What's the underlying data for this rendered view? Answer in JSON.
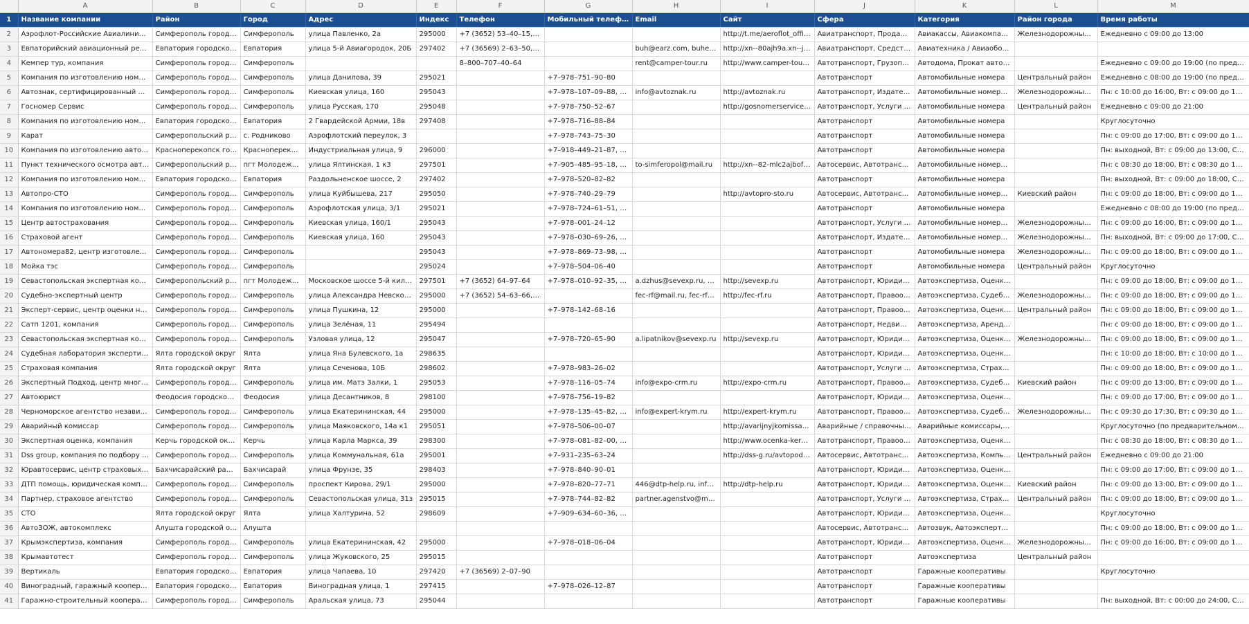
{
  "columns": [
    "A",
    "B",
    "C",
    "D",
    "E",
    "F",
    "G",
    "H",
    "I",
    "J",
    "K",
    "L",
    "M"
  ],
  "header": [
    "Название компании",
    "Район",
    "Город",
    "Адрес",
    "Индекс",
    "Телефон",
    "Мобильный телефон",
    "Email",
    "Сайт",
    "Сфера",
    "Категория",
    "Район города",
    "Время работы"
  ],
  "rows": [
    [
      "Аэрофлот-Российские Авиалинии, ав...",
      "Симферополь городск...",
      "Симферополь",
      "улица Павленко, 2а",
      "295000",
      "+7 (3652) 53–40–15, +7...",
      "",
      "",
      "http://t.me/aeroflot_offici...",
      "Авиатранспорт, Продажа ...",
      "Авиакассы, Авиакомпании",
      "Железнодорожный р...",
      "Ежедневно с 09:00 до 13:00"
    ],
    [
      "Евпаторийский авиационный ремонт...",
      "Евпатория городской ...",
      "Евпатория",
      "улица 5-й Авиагородок, 20Б",
      "297402",
      "+7 (36569) 2–63–50, +7...",
      "",
      "buh@earz.com, buhear...",
      "http://xn--80ajh9a.xn--j1a...",
      "Авиатранспорт, Средства ...",
      "Авиатехника / Авиаобору...",
      "",
      ""
    ],
    [
      "Кемпер тур, компания",
      "Симферополь городск...",
      "Симферополь",
      "",
      "",
      "8–800–707–40–64",
      "",
      "rent@camper-tour.ru",
      "http://www.camper-tour.ru",
      "Автотранспорт, Грузопере...",
      "Автодома, Прокат автотра...",
      "",
      "Ежедневно с 09:00 до 19:00 (по предвари..."
    ],
    [
      "Компания по изготовлению номерны...",
      "Симферополь городск...",
      "Симферополь",
      "улица Данилова, 39",
      "295021",
      "",
      "+7–978–751–90–80",
      "",
      "",
      "Автотранспорт",
      "Автомобильные номера",
      "Центральный район",
      "Ежедневно с 08:00 до 19:00 (по предвари..."
    ],
    [
      "Автознак, сертифицированный центр",
      "Симферополь городск...",
      "Симферополь",
      "Киевская улица, 160",
      "295043",
      "",
      "+7–978–107–09–88, +7...",
      "info@avtoznak.ru",
      "http://avtoznak.ru",
      "Автотранспорт, Издательс...",
      "Автомобильные номера, К...",
      "Железнодорожный р...",
      "Пн: с 10:00 до 16:00, Вт: с 09:00 до 18:00, С..."
    ],
    [
      "Госномер Сервис",
      "Симферополь городск...",
      "Симферополь",
      "улица Русская, 170",
      "295048",
      "",
      "+7–978–750–52–67",
      "",
      "http://gosnomerservice.ru",
      "Автотранспорт, Услуги стр...",
      "Автомобильные номера",
      "Центральный район",
      "Ежедневно с 09:00 до 21:00"
    ],
    [
      "Компания по изготовлению номерны...",
      "Евпатория городской ...",
      "Евпатория",
      "2 Гвардейской Армии, 18в",
      "297408",
      "",
      "+7–978–716–88–84",
      "",
      "",
      "Автотранспорт",
      "Автомобильные номера",
      "",
      "Круглосуточно"
    ],
    [
      "Карат",
      "Симферопольский рай...",
      "с. Родниково",
      "Аэрофлотский переулок, 3",
      "",
      "",
      "+7–978–743–75–30",
      "",
      "",
      "Автотранспорт",
      "Автомобильные номера",
      "",
      "Пн: с 09:00 до 17:00, Вт: с 09:00 до 17:00, С..."
    ],
    [
      "Компания по изготовлению автомоб...",
      "Красноперекопск горо...",
      "Красноперекоп...",
      "Индустриальная улица, 9",
      "296000",
      "",
      "+7–918–449–21–87, +7...",
      "",
      "",
      "Автотранспорт",
      "Автомобильные номера",
      "",
      "Пн: выходной, Вт: с 09:00 до 13:00, Ср: с 0..."
    ],
    [
      "Пункт технического осмотра автотра...",
      "Симферопольский рай...",
      "пгт Молодежное",
      "улица Ялтинская, 1 к3",
      "297501",
      "",
      "+7–905–485–95–18, +7...",
      "to-simferopol@mail.ru",
      "http://xn--82-mlc2ajbofgf...",
      "Автосервис, Автотранспор...",
      "Автомобильные номера, ...",
      "",
      "Пн: с 08:30 до 18:00, Вт: с 08:30 до 18:00, С..."
    ],
    [
      "Компания по изготовлению номерны...",
      "Евпатория городской ...",
      "Евпатория",
      "Раздольненское шоссе, 2",
      "297402",
      "",
      "+7–978–520–82–82",
      "",
      "",
      "Автотранспорт",
      "Автомобильные номера",
      "",
      "Пн: выходной, Вт: с 09:00 до 18:00, Ср: с 0..."
    ],
    [
      "Автопро-СТО",
      "Симферополь городск...",
      "Симферополь",
      "улица Куйбышева, 217",
      "295050",
      "",
      "+7–978–740–29–79",
      "",
      "http://avtopro-sto.ru",
      "Автосервис, Автотранспорт",
      "Автомобильные номера, А...",
      "Киевский район",
      "Пн: с 09:00 до 18:00, Вт: с 09:00 до 18:00, С..."
    ],
    [
      "Компания по изготовлению номерны...",
      "Симферополь городск...",
      "Симферополь",
      "Аэрофлотская улица, 3/1",
      "295021",
      "",
      "+7–978–724–61–51, +7...",
      "",
      "",
      "Автотранспорт",
      "Автомобильные номера",
      "",
      "Ежедневно с 08:00 до 19:00 (по предвари..."
    ],
    [
      "Центр автострахования",
      "Симферополь городск...",
      "Симферополь",
      "Киевская улица, 160/1",
      "295043",
      "",
      "+7–978–001–24–12",
      "",
      "",
      "Автотранспорт, Услуги стр...",
      "Автомобильные номера, С...",
      "Железнодорожный р...",
      "Пн: с 09:00 до 16:00, Вт: с 09:00 до 17:00, С..."
    ],
    [
      "Страховой агент",
      "Симферополь городск...",
      "Симферополь",
      "Киевская улица, 160",
      "295043",
      "",
      "+7–978–030–69–26, +7...",
      "",
      "",
      "Автотранспорт, Издательс...",
      "Автомобильные номера, К...",
      "Железнодорожный р...",
      "Пн: выходной, Вт: с 09:00 до 17:00, Ср: с 0..."
    ],
    [
      "Автономера82, центр изготовления н...",
      "Симферополь городск...",
      "Симферополь",
      "",
      "295043",
      "",
      "+7–978–869–73–98, +7...",
      "",
      "",
      "Автотранспорт",
      "Автомобильные номера",
      "Железнодорожный р...",
      "Пн: с 09:00 до 18:00, Вт: с 09:00 до 18:00, С..."
    ],
    [
      "Мойка тэс",
      "Симферополь городск...",
      "Симферополь",
      "",
      "295024",
      "",
      "+7–978–504–06–40",
      "",
      "",
      "Автотранспорт",
      "Автомобильные номера",
      "Центральный район",
      "Круглосуточно"
    ],
    [
      "Севастопольская экспертная компания",
      "Симферопольский рай...",
      "пгт Молодежное",
      "Московское шоссе 5-й килом...",
      "297501",
      "+7 (3652) 64–97–64",
      "+7–978–010–92–35, +7...",
      "a.dzhus@sevexp.ru, a.sc...",
      "http://sevexp.ru",
      "Автотранспорт, Юридичес...",
      "Автоэкспертиза, Оценка с...",
      "",
      "Пн: с 09:00 до 18:00, Вт: с 09:00 до 18:00, С..."
    ],
    [
      "Судебно-экспертный центр",
      "Симферополь городск...",
      "Симферополь",
      "улица Александра Невского, 12",
      "295000",
      "+7 (3652) 54–63–66, 8–...",
      "",
      "fec-rf@mail.ru, fec-rf12...",
      "http://fec-rf.ru",
      "Автотранспорт, Правоохр...",
      "Автоэкспертиза, Судебная ...",
      "Железнодорожный р...",
      "Пн: с 09:00 до 18:00, Вт: с 09:00 до 18:00, С..."
    ],
    [
      "Эксперт-сервис, центр оценки недви...",
      "Симферополь городск...",
      "Симферополь",
      "улица Пушкина, 12",
      "295000",
      "",
      "+7–978–142–68–16",
      "",
      "",
      "Автотранспорт, Правоохр...",
      "Автоэкспертиза, Оценка с...",
      "Центральный район",
      "Пн: с 09:00 до 18:00, Вт: с 09:00 до 18:00, С..."
    ],
    [
      "Сатп 1201, компания",
      "Симферополь городск...",
      "Симферополь",
      "улица Зелёная, 11",
      "295494",
      "",
      "",
      "",
      "",
      "Автотранспорт, Недвижим...",
      "Автоэкспертиза, Аренда п...",
      "",
      "Пн: с 09:00 до 18:00, Вт: с 09:00 до 18:00, С..."
    ],
    [
      "Севастопольская экспертная компания",
      "Симферополь городск...",
      "Симферополь",
      "Узловая улица, 12",
      "295047",
      "",
      "+7–978–720–65–90",
      "a.lipatnikov@sevexp.ru",
      "http://sevexp.ru",
      "Автотранспорт, Юридичес...",
      "Автоэкспертиза, Оценка с...",
      "Железнодорожный р...",
      "Пн: с 09:00 до 18:00, Вт: с 09:00 до 18:00, С..."
    ],
    [
      "Судебная лаборатория экспертизы и ...",
      "Ялта городской округ",
      "Ялта",
      "улица Яна Булевского, 1а",
      "298635",
      "",
      "",
      "",
      "",
      "Автотранспорт, Юридичес...",
      "Автоэкспертиза, Оценка с...",
      "",
      "Пн: с 10:00 до 18:00, Вт: с 10:00 до 18:00, С..."
    ],
    [
      "Страховая компания",
      "Ялта городской округ",
      "Ялта",
      "улица Сеченова, 10Б",
      "298602",
      "",
      "+7–978–983–26–02",
      "",
      "",
      "Автотранспорт, Услуги стр...",
      "Автоэкспертиза, Страхова...",
      "",
      "Пн: с 09:00 до 18:00, Вт: с 09:00 до 18:00, С..."
    ],
    [
      "Экспертный Подход, центр многопро...",
      "Симферополь городск...",
      "Симферополь",
      "улица им. Матэ Залки, 1",
      "295053",
      "",
      "+7–978–116–05–74",
      "info@expo-crm.ru",
      "http://expo-crm.ru",
      "Автотранспорт, Правоохр...",
      "Автоэкспертиза, Судебная ...",
      "Киевский район",
      "Пн: с 09:00 до 13:00, Вт: с 09:00 до 13:00, С..."
    ],
    [
      "Автоюрист",
      "Феодосия городской о...",
      "Феодосия",
      "улица Десантников, 8",
      "298100",
      "",
      "+7–978–756–19–82",
      "",
      "",
      "Автотранспорт, Юридичес...",
      "Автоэкспертиза, Оценка с...",
      "",
      "Пн: с 09:00 до 17:00, Вт: с 09:00 до 17:00, С..."
    ],
    [
      "Черноморское агентство независимы...",
      "Симферополь городск...",
      "Симферополь",
      "улица Екатерининская, 44",
      "295000",
      "",
      "+7–978–135–45–82, +7...",
      "info@expert-krym.ru",
      "http://expert-krym.ru",
      "Автотранспорт, Правоохр...",
      "Автоэкспертиза, Судебная ...",
      "Железнодорожный р...",
      "Пн: с 09:30 до 17:30, Вт: с 09:30 до 17:30, С..."
    ],
    [
      "Аварийный комиссар",
      "Симферополь городск...",
      "Симферополь",
      "улица Маяковского, 14а к1",
      "295051",
      "",
      "+7–978–506–00–07",
      "",
      "http://avarijnyjkomissarsi...",
      "Аварийные / справочные ...",
      "Аварийные комиссары, Ав...",
      "",
      "Круглосуточно (по предварительному зв..."
    ],
    [
      "Экспертная оценка, компания",
      "Керчь городской округ",
      "Керчь",
      "улица Карла Маркса, 39",
      "298300",
      "",
      "+7–978–081–82–00, +7...",
      "",
      "http://www.ocenka-kerch.ru",
      "Автотранспорт, Правоохр...",
      "Автоэкспертиза, Оценка с...",
      "",
      "Пн: с 08:30 до 18:00, Вт: с 08:30 до 17:00, С..."
    ],
    [
      "Dss group, компания по подбору авт...",
      "Симферополь городск...",
      "Симферополь",
      "улица Коммунальная, 61а",
      "295001",
      "",
      "+7–931–235–63–24",
      "",
      "http://dss-g.ru/avtopodb...",
      "Автосервис, Автотранспорт",
      "Автоэкспертиза, Компьют...",
      "Центральный район",
      "Ежедневно с 09:00 до 21:00"
    ],
    [
      "Юравтосервис, центр страховых услуг",
      "Бахчисарайский район",
      "Бахчисарай",
      "улица Фрунзе, 35",
      "298403",
      "",
      "+7–978–840–90–01",
      "",
      "",
      "Автотранспорт, Юридичес...",
      "Автоэкспертиза, Оценка с...",
      "",
      "Пн: с 09:00 до 17:00, Вт: с 09:00 до 17:00, С..."
    ],
    [
      "ДТП помощь, юридическая компания",
      "Симферополь городск...",
      "Симферополь",
      "проспект Кирова, 29/1",
      "295000",
      "",
      "+7–978–820–77–71",
      "446@dtp-help.ru, info...",
      "http://dtp-help.ru",
      "Автотранспорт, Юридичес...",
      "Автоэкспертиза, Оценка с...",
      "Киевский район",
      "Пн: с 09:00 до 13:00, Вт: с 09:00 до 13:00, С..."
    ],
    [
      "Партнер, страховое агентство",
      "Симферополь городск...",
      "Симферополь",
      "Севастопольская улица, 31з",
      "295015",
      "",
      "+7–978–744–82–82",
      "partner.agenstvo@mail.ru",
      "",
      "Автотранспорт, Услуги стр...",
      "Автоэкспертиза, Страхова...",
      "Центральный район",
      "Пн: с 09:00 до 18:00, Вт: с 09:00 до 18:00, С..."
    ],
    [
      "СТО",
      "Ялта городской округ",
      "Ялта",
      "улица Халтурина, 52",
      "298609",
      "",
      "+7–909–634–60–36, +7...",
      "",
      "",
      "Автотранспорт, Юридичес...",
      "Автоэкспертиза, Оценка с...",
      "",
      "Круглосуточно"
    ],
    [
      "АвтоЗОЖ, автокомплекс",
      "Алушта городской округ",
      "Алушта",
      "",
      "",
      "",
      "",
      "",
      "",
      "Автосервис, Автотранспорт",
      "Автозвук, Автоэкспертиза, ...",
      "",
      "Пн: с 09:00 до 18:00, Вт: с 09:00 до 18:00, С..."
    ],
    [
      "Крымэкспертиза, компания",
      "Симферополь городск...",
      "Симферополь",
      "улица Екатерининская, 42",
      "295000",
      "",
      "+7–978–018–06–04",
      "",
      "",
      "Автотранспорт, Юридичес...",
      "Автоэкспертиза, Оценка с...",
      "Железнодорожный р...",
      "Пн: с 09:00 до 16:00, Вт: с 09:00 до 16:00, С..."
    ],
    [
      "Крымавтотест",
      "Симферополь городск...",
      "Симферополь",
      "улица Жуковского, 25",
      "295015",
      "",
      "",
      "",
      "",
      "Автотранспорт",
      "Автоэкспертиза",
      "Центральный район",
      ""
    ],
    [
      "Вертикаль",
      "Евпатория городской ...",
      "Евпатория",
      "улица Чапаева, 10",
      "297420",
      "+7 (36569) 2–07–90",
      "",
      "",
      "",
      "Автотранспорт",
      "Гаражные кооперативы",
      "",
      "Круглосуточно"
    ],
    [
      "Виноградный, гаражный кооператив",
      "Евпатория городской ...",
      "Евпатория",
      "Виноградная улица, 1",
      "297415",
      "",
      "+7–978–026–12–87",
      "",
      "",
      "Автотранспорт",
      "Гаражные кооперативы",
      "",
      ""
    ],
    [
      "Гаражно-строительный кооператив ...",
      "Симферополь городск...",
      "Симферополь",
      "Аральская улица, 73",
      "295044",
      "",
      "",
      "",
      "",
      "Автотранспорт",
      "Гаражные кооперативы",
      "",
      "Пн: выходной, Вт: с 00:00 до 24:00, Ср: с 0..."
    ]
  ]
}
